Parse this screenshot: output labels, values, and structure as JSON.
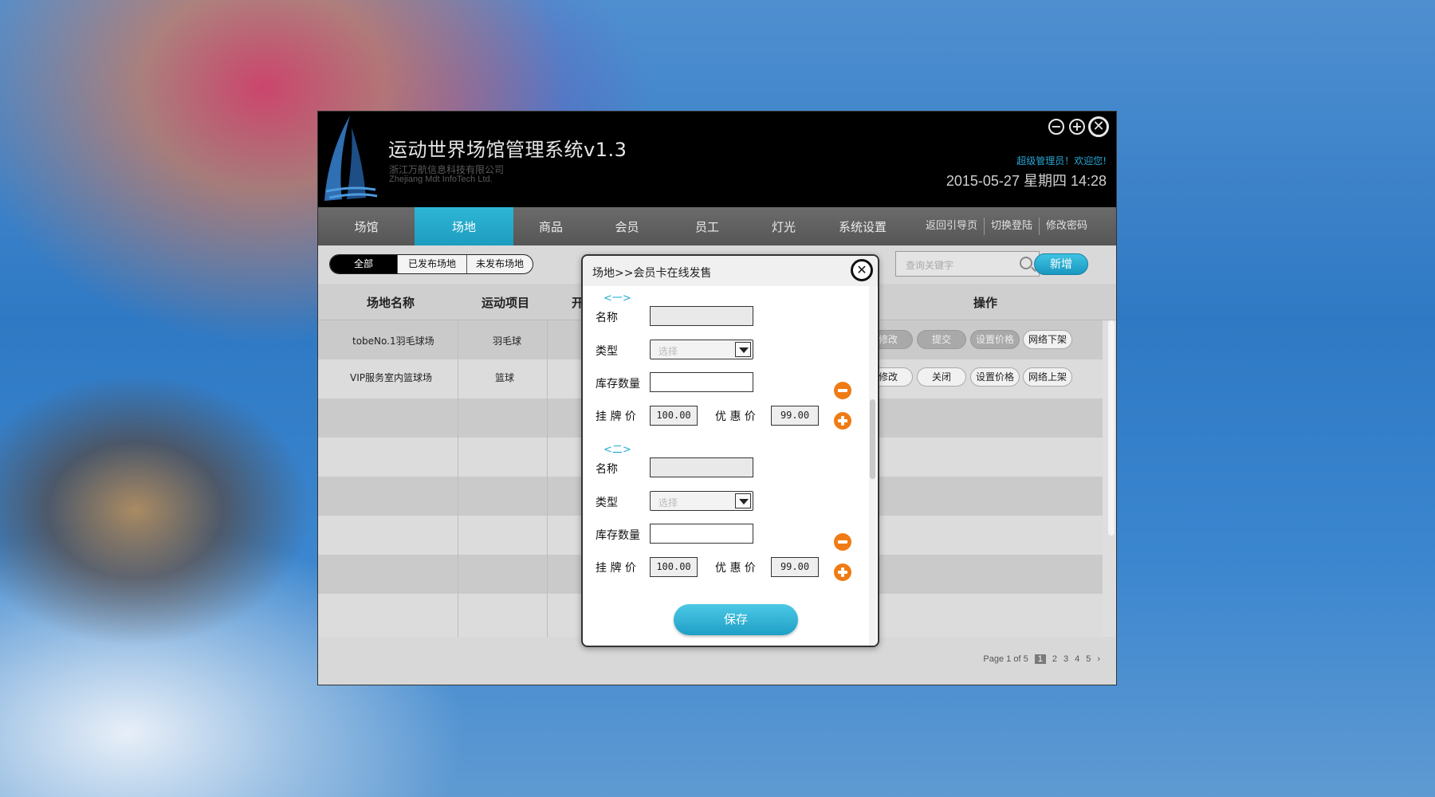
{
  "header": {
    "title": "运动世界场馆管理系统v1.3",
    "company_cn": "浙江万航信息科技有限公司",
    "company_en": "Zhejiang Mdt InfoTech Ltd.",
    "welcome": "超级管理员！欢迎您!",
    "datetime": "2015-05-27 星期四 14:28",
    "window_controls": {
      "minimize": "−",
      "maximize": "+",
      "close": "✕"
    }
  },
  "nav": {
    "items": [
      "场馆",
      "场地",
      "商品",
      "会员",
      "员工",
      "灯光",
      "系统设置"
    ],
    "active": "场地",
    "links": [
      "返回引导页",
      "切换登陆",
      "修改密码"
    ]
  },
  "filter": {
    "tabs": [
      "全部",
      "已发布场地",
      "未发布场地"
    ],
    "active": "全部"
  },
  "search": {
    "placeholder": "查询关键字"
  },
  "add_button": "新增",
  "table": {
    "headers": [
      "场地名称",
      "运动项目",
      "开",
      "操作"
    ],
    "rows": [
      {
        "name": "tobeNo.1羽毛球场",
        "sport": "羽毛球",
        "actions": [
          "修改",
          "提交",
          "设置价格",
          "网络下架"
        ]
      },
      {
        "name": "VIP服务室内篮球场",
        "sport": "篮球",
        "actions": [
          "修改",
          "关闭",
          "设置价格",
          "网络上架"
        ]
      }
    ]
  },
  "pager": {
    "summary": "Page 1 of 5",
    "pages": [
      "1",
      "2",
      "3",
      "4",
      "5"
    ],
    "current": "1",
    "next": "›"
  },
  "modal": {
    "title": "场地>>会员卡在线发售",
    "close": "✕",
    "sections": [
      {
        "label": "<一>",
        "name_label": "名称",
        "type_label": "类型",
        "type_placeholder": "选择",
        "stock_label": "库存数量",
        "list_price_label": "挂 牌 价",
        "list_price": "100.00",
        "discount_label": "优 惠 价",
        "discount_price": "99.00"
      },
      {
        "label": "<二>",
        "name_label": "名称",
        "type_label": "类型",
        "type_placeholder": "选择",
        "stock_label": "库存数量",
        "list_price_label": "挂 牌 价",
        "list_price": "100.00",
        "discount_label": "优 惠 价",
        "discount_price": "99.00"
      }
    ],
    "save": "保存"
  },
  "colors": {
    "accent": "#1d9cc0",
    "section_label": "#24a9d6",
    "add_remove": "#f07b14"
  }
}
